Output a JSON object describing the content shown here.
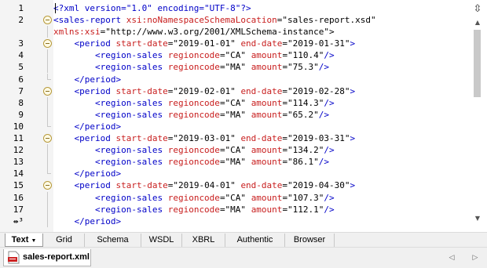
{
  "editor": {
    "lines": [
      {
        "n": "1",
        "fold": "none",
        "tokens": [
          {
            "t": "<?xml version=\"1.0\" encoding=\"UTF-8\"?>",
            "c": "bl"
          }
        ]
      },
      {
        "n": "2",
        "fold": "open",
        "tokens": [
          {
            "t": "<sales-report ",
            "c": "bl"
          },
          {
            "t": "xsi:noNamespaceSchemaLocation",
            "c": "rd"
          },
          {
            "t": "=\"sales-report.xsd\"",
            "c": "bk"
          }
        ]
      },
      {
        "n": "",
        "fold": "guide",
        "tokens": [
          {
            "t": "xmlns:xsi",
            "c": "rd"
          },
          {
            "t": "=\"http://www.w3.org/2001/XMLSchema-instance\">",
            "c": "bk"
          }
        ]
      },
      {
        "n": "3",
        "fold": "open",
        "tokens": [
          {
            "t": "    <period ",
            "c": "bl"
          },
          {
            "t": "start-date",
            "c": "rd"
          },
          {
            "t": "=\"2019-01-01\" ",
            "c": "bk"
          },
          {
            "t": "end-date",
            "c": "rd"
          },
          {
            "t": "=\"2019-01-31\"",
            "c": "bk"
          },
          {
            "t": ">",
            "c": "bl"
          }
        ]
      },
      {
        "n": "4",
        "fold": "guide",
        "tokens": [
          {
            "t": "        <region-sales ",
            "c": "bl"
          },
          {
            "t": "regioncode",
            "c": "rd"
          },
          {
            "t": "=\"CA\" ",
            "c": "bk"
          },
          {
            "t": "amount",
            "c": "rd"
          },
          {
            "t": "=\"110.4\"",
            "c": "bk"
          },
          {
            "t": "/>",
            "c": "bl"
          }
        ]
      },
      {
        "n": "5",
        "fold": "guide",
        "tokens": [
          {
            "t": "        <region-sales ",
            "c": "bl"
          },
          {
            "t": "regioncode",
            "c": "rd"
          },
          {
            "t": "=\"MA\" ",
            "c": "bk"
          },
          {
            "t": "amount",
            "c": "rd"
          },
          {
            "t": "=\"75.3\"",
            "c": "bk"
          },
          {
            "t": "/>",
            "c": "bl"
          }
        ]
      },
      {
        "n": "6",
        "fold": "end",
        "tokens": [
          {
            "t": "    </period>",
            "c": "bl"
          }
        ]
      },
      {
        "n": "7",
        "fold": "open",
        "tokens": [
          {
            "t": "    <period ",
            "c": "bl"
          },
          {
            "t": "start-date",
            "c": "rd"
          },
          {
            "t": "=\"2019-02-01\" ",
            "c": "bk"
          },
          {
            "t": "end-date",
            "c": "rd"
          },
          {
            "t": "=\"2019-02-28\"",
            "c": "bk"
          },
          {
            "t": ">",
            "c": "bl"
          }
        ]
      },
      {
        "n": "8",
        "fold": "guide",
        "tokens": [
          {
            "t": "        <region-sales ",
            "c": "bl"
          },
          {
            "t": "regioncode",
            "c": "rd"
          },
          {
            "t": "=\"CA\" ",
            "c": "bk"
          },
          {
            "t": "amount",
            "c": "rd"
          },
          {
            "t": "=\"114.3\"",
            "c": "bk"
          },
          {
            "t": "/>",
            "c": "bl"
          }
        ]
      },
      {
        "n": "9",
        "fold": "guide",
        "tokens": [
          {
            "t": "        <region-sales ",
            "c": "bl"
          },
          {
            "t": "regioncode",
            "c": "rd"
          },
          {
            "t": "=\"MA\" ",
            "c": "bk"
          },
          {
            "t": "amount",
            "c": "rd"
          },
          {
            "t": "=\"65.2\"",
            "c": "bk"
          },
          {
            "t": "/>",
            "c": "bl"
          }
        ]
      },
      {
        "n": "10",
        "fold": "end",
        "tokens": [
          {
            "t": "    </period>",
            "c": "bl"
          }
        ]
      },
      {
        "n": "11",
        "fold": "open",
        "tokens": [
          {
            "t": "    <period ",
            "c": "bl"
          },
          {
            "t": "start-date",
            "c": "rd"
          },
          {
            "t": "=\"2019-03-01\" ",
            "c": "bk"
          },
          {
            "t": "end-date",
            "c": "rd"
          },
          {
            "t": "=\"2019-03-31\"",
            "c": "bk"
          },
          {
            "t": ">",
            "c": "bl"
          }
        ]
      },
      {
        "n": "12",
        "fold": "guide",
        "tokens": [
          {
            "t": "        <region-sales ",
            "c": "bl"
          },
          {
            "t": "regioncode",
            "c": "rd"
          },
          {
            "t": "=\"CA\" ",
            "c": "bk"
          },
          {
            "t": "amount",
            "c": "rd"
          },
          {
            "t": "=\"134.2\"",
            "c": "bk"
          },
          {
            "t": "/>",
            "c": "bl"
          }
        ]
      },
      {
        "n": "13",
        "fold": "guide",
        "tokens": [
          {
            "t": "        <region-sales ",
            "c": "bl"
          },
          {
            "t": "regioncode",
            "c": "rd"
          },
          {
            "t": "=\"MA\" ",
            "c": "bk"
          },
          {
            "t": "amount",
            "c": "rd"
          },
          {
            "t": "=\"86.1\"",
            "c": "bk"
          },
          {
            "t": "/>",
            "c": "bl"
          }
        ]
      },
      {
        "n": "14",
        "fold": "end",
        "tokens": [
          {
            "t": "    </period>",
            "c": "bl"
          }
        ]
      },
      {
        "n": "15",
        "fold": "open",
        "tokens": [
          {
            "t": "    <period ",
            "c": "bl"
          },
          {
            "t": "start-date",
            "c": "rd"
          },
          {
            "t": "=\"2019-04-01\" ",
            "c": "bk"
          },
          {
            "t": "end-date",
            "c": "rd"
          },
          {
            "t": "=\"2019-04-30\"",
            "c": "bk"
          },
          {
            "t": ">",
            "c": "bl"
          }
        ]
      },
      {
        "n": "16",
        "fold": "guide",
        "tokens": [
          {
            "t": "        <region-sales ",
            "c": "bl"
          },
          {
            "t": "regioncode",
            "c": "rd"
          },
          {
            "t": "=\"CA\" ",
            "c": "bk"
          },
          {
            "t": "amount",
            "c": "rd"
          },
          {
            "t": "=\"107.3\"",
            "c": "bk"
          },
          {
            "t": "/>",
            "c": "bl"
          }
        ]
      },
      {
        "n": "17",
        "fold": "guide",
        "tokens": [
          {
            "t": "        <region-sales ",
            "c": "bl"
          },
          {
            "t": "regioncode",
            "c": "rd"
          },
          {
            "t": "=\"MA\" ",
            "c": "bk"
          },
          {
            "t": "amount",
            "c": "rd"
          },
          {
            "t": "=\"112.1\"",
            "c": "bk"
          },
          {
            "t": "/>",
            "c": "bl"
          }
        ]
      },
      {
        "n": "⇹³",
        "fold": "guide",
        "tokens": [
          {
            "t": "    </period>",
            "c": "bl"
          }
        ]
      }
    ]
  },
  "colors": {
    "tag": "#0000c8",
    "attribute": "#c81e1e",
    "value": "#000000",
    "gutter": "#f4f4f4",
    "tabbar": "#f0f0f0"
  },
  "scrollbar": {
    "split_icon": "⇳",
    "up_arrow": "▲",
    "down_arrow": "▼"
  },
  "view_tabs": [
    {
      "label": "Text",
      "active": true,
      "caret": "▼"
    },
    {
      "label": "Grid",
      "active": false
    },
    {
      "label": "Schema",
      "active": false
    },
    {
      "label": "WSDL",
      "active": false
    },
    {
      "label": "XBRL",
      "active": false
    },
    {
      "label": "Authentic",
      "active": false
    },
    {
      "label": "Browser",
      "active": false
    }
  ],
  "file_tabs": {
    "active_file": "sales-report.xml",
    "icon": "xml-file-icon",
    "prev_arrow": "◁",
    "next_arrow": "▷"
  }
}
